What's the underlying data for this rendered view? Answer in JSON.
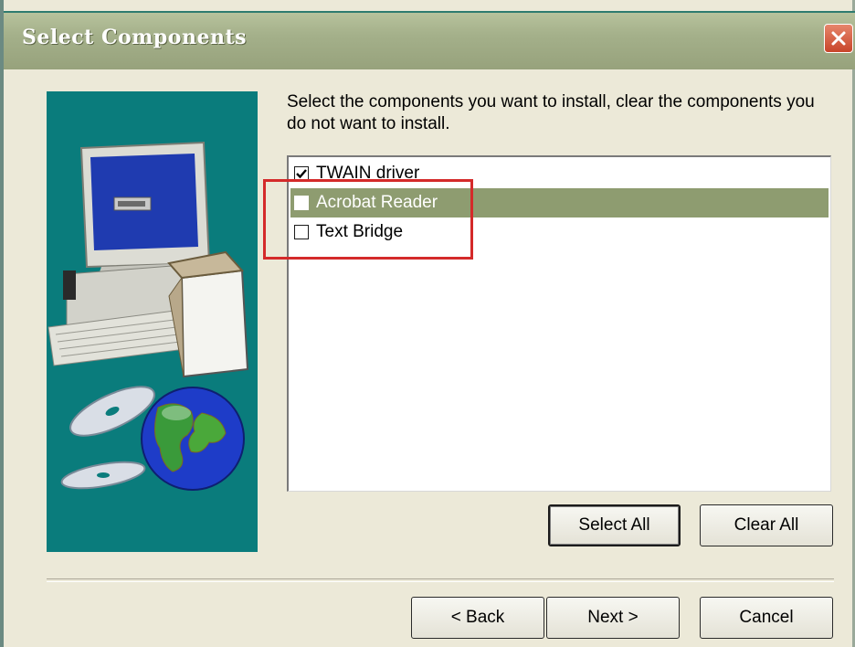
{
  "window": {
    "title": "Select Components"
  },
  "instructions": "Select the components you want to install, clear the components you do not want to install.",
  "components": [
    {
      "label": "TWAIN driver",
      "checked": true,
      "selected": false
    },
    {
      "label": "Acrobat Reader",
      "checked": false,
      "selected": true
    },
    {
      "label": "Text Bridge",
      "checked": false,
      "selected": false
    }
  ],
  "buttons": {
    "select_all": "Select All",
    "clear_all": "Clear All",
    "back": "< Back",
    "next": "Next >",
    "cancel": "Cancel"
  },
  "colors": {
    "title_bar": "#a4b08a",
    "art_background": "#0a7c7c",
    "selection": "#8e9c70",
    "highlight": "#d42a2a"
  }
}
